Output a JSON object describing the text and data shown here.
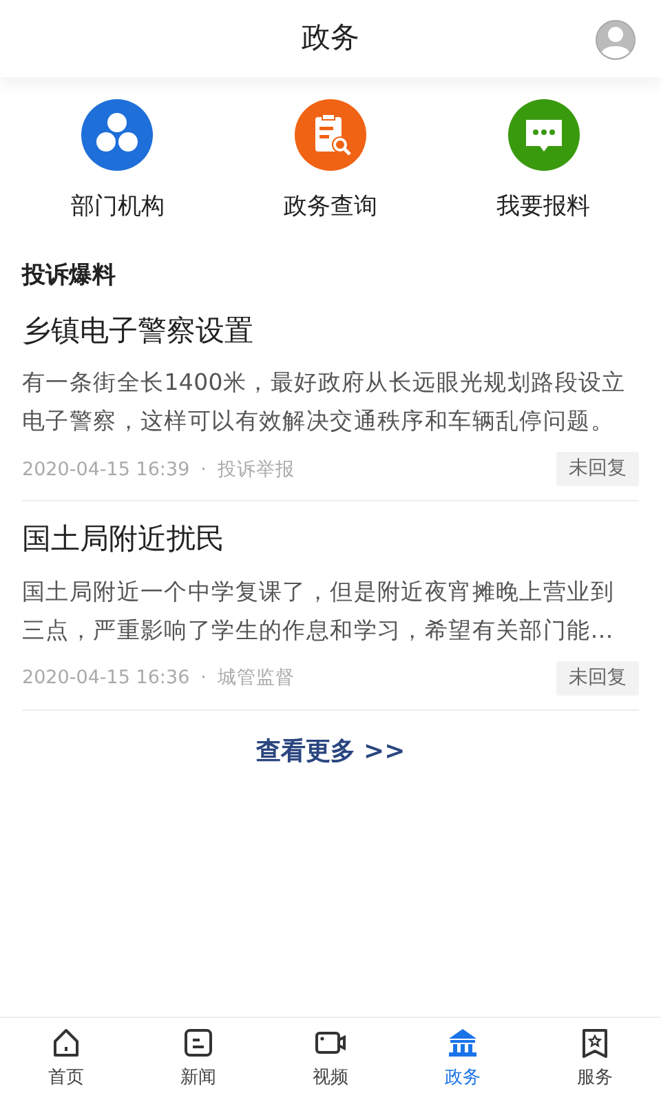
{
  "header": {
    "title": "政务"
  },
  "shortcuts": [
    {
      "label": "部门机构",
      "color": "#1e6fd9"
    },
    {
      "label": "政务查询",
      "color": "#f06314"
    },
    {
      "label": "我要报料",
      "color": "#3a9a0e"
    }
  ],
  "section": {
    "title": "投诉爆料"
  },
  "posts": [
    {
      "title": "乡镇电子警察设置",
      "body": "有一条街全长1400米，最好政府从长远眼光规划路段设立电子警察，这样可以有效解决交通秩序和车辆乱停问题。",
      "time": "2020-04-15 16:39",
      "separator": "·",
      "category": "投诉举报",
      "status": "未回复"
    },
    {
      "title": "国土局附近扰民",
      "body": "国土局附近一个中学复课了，但是附近夜宵摊晚上营业到三点，严重影响了学生的作息和学习，希望有关部门能…",
      "time": "2020-04-15 16:36",
      "separator": "·",
      "category": "城管监督",
      "status": "未回复"
    }
  ],
  "more_link": "查看更多 >>",
  "tabbar": [
    {
      "label": "首页",
      "selected": false
    },
    {
      "label": "新闻",
      "selected": false
    },
    {
      "label": "视频",
      "selected": false
    },
    {
      "label": "政务",
      "selected": true
    },
    {
      "label": "服务",
      "selected": false
    }
  ]
}
